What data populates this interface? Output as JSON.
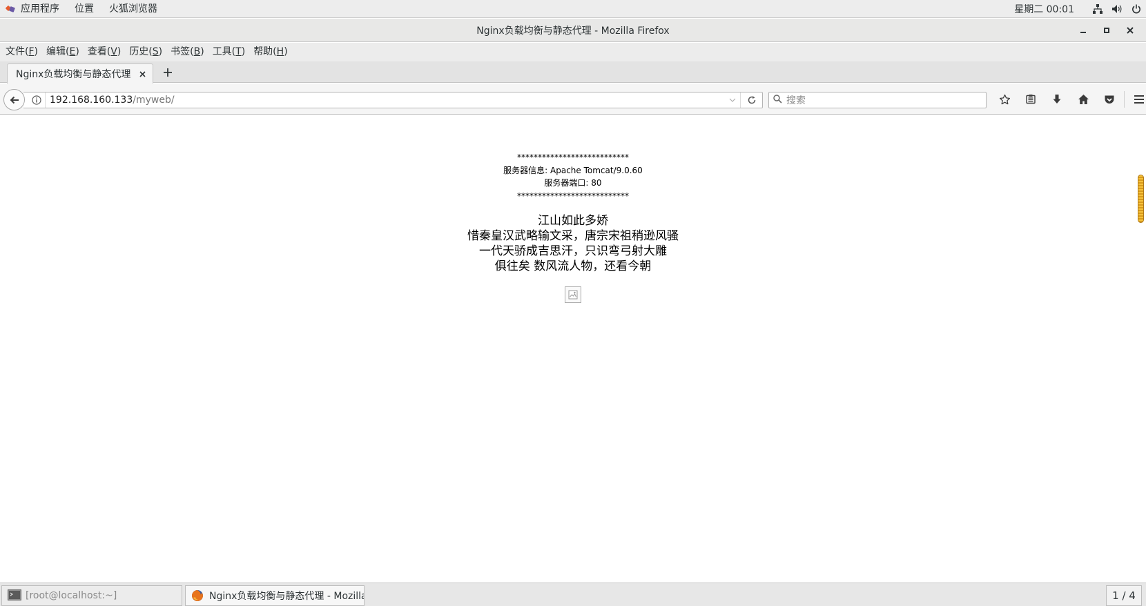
{
  "top_panel": {
    "apps_label": "应用程序",
    "places_label": "位置",
    "browser_label": "火狐浏览器",
    "clock": "星期二 00:01",
    "icons": [
      "network-icon",
      "volume-icon",
      "power-icon"
    ]
  },
  "window": {
    "title": "Nginx负载均衡与静态代理  -  Mozilla Firefox"
  },
  "menubar": {
    "items": [
      {
        "label": "文件(",
        "key": "F",
        "end": ")"
      },
      {
        "label": "编辑(",
        "key": "E",
        "end": ")"
      },
      {
        "label": "查看(",
        "key": "V",
        "end": ")"
      },
      {
        "label": "历史(",
        "key": "S",
        "end": ")"
      },
      {
        "label": "书签(",
        "key": "B",
        "end": ")"
      },
      {
        "label": "工具(",
        "key": "T",
        "end": ")"
      },
      {
        "label": "帮助(",
        "key": "H",
        "end": ")"
      }
    ]
  },
  "tabs": [
    {
      "label": "Nginx负载均衡与静态代理",
      "active": true
    }
  ],
  "navbar": {
    "url_host": "192.168.160.133",
    "url_path": "/myweb/",
    "search_placeholder": "搜索"
  },
  "page": {
    "stars_top": "***************************",
    "server_info": "服务器信息: Apache Tomcat/9.0.60",
    "server_port": "服务器端口: 80",
    "stars_bottom": "***************************",
    "poem": [
      "江山如此多娇",
      "惜秦皇汉武略输文采，唐宗宋祖稍逊风骚",
      "一代天骄成吉思汗，只识弯弓射大雕",
      "俱往矣 数风流人物，还看今朝"
    ]
  },
  "taskbar": {
    "task1": "[root@localhost:~]",
    "task2": "Nginx负载均衡与静态代理 - Mozilla …",
    "workspace": "1 / 4"
  },
  "colors": {
    "panel_bg": "#ededed",
    "toolbar_bg": "#f5f5f5",
    "scroll_thumb": "#f5c23b"
  }
}
